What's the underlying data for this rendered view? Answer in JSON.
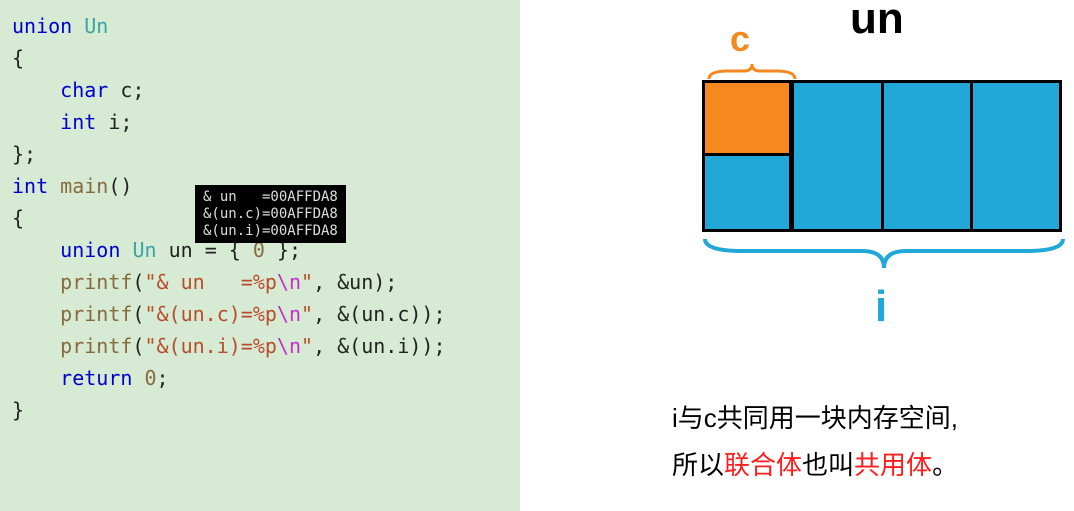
{
  "code": {
    "l1_kw": "union",
    "l1_ty": "Un",
    "l2": "{",
    "l3_kw": "char",
    "l3_id": " c;",
    "l4_kw": "int",
    "l4_id": " i;",
    "l5": "};",
    "l6_kw": "int",
    "l6_fn": "main",
    "l6_pr": "()",
    "l7": "{",
    "l8_kw": "union",
    "l8_ty": "Un",
    "l8_id": " un = { ",
    "l8_n": "0",
    "l8_end": " };",
    "l9_fn": "printf",
    "l9_p1": "(",
    "l9_s1": "\"& un   =%p",
    "l9_esc": "\\n",
    "l9_s2": "\"",
    "l9_p2": ", &un);",
    "l10_fn": "printf",
    "l10_p1": "(",
    "l10_s1": "\"&(un.c)=%p",
    "l10_esc": "\\n",
    "l10_s2": "\"",
    "l10_p2": ", &(un.c));",
    "l11_fn": "printf",
    "l11_p1": "(",
    "l11_s1": "\"&(un.i)=%p",
    "l11_esc": "\\n",
    "l11_s2": "\"",
    "l11_p2": ", &(un.i));",
    "l12_kw": "return",
    "l12_n": "0",
    "l12_end": ";",
    "l13": "}"
  },
  "tooltip": "& un   =00AFFDA8\n&(un.c)=00AFFDA8\n&(un.i)=00AFFDA8",
  "diagram": {
    "un_label": "un",
    "c_label": "c",
    "i_label": "i"
  },
  "explain": {
    "line1a": "i与c共同用一块内存空间,",
    "line2a": "所以",
    "line2b": "联合体",
    "line2c": "也叫",
    "line2d": "共用体",
    "line2e": "。"
  }
}
